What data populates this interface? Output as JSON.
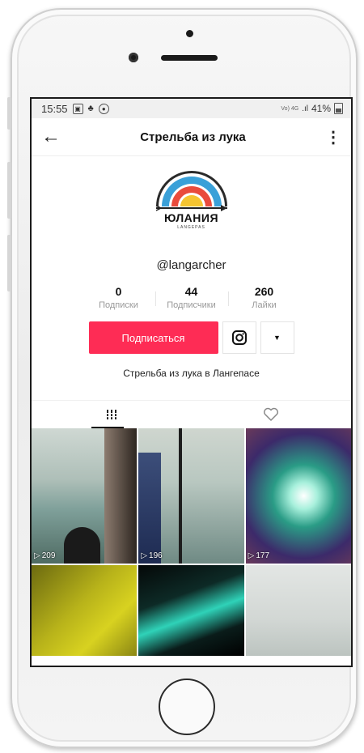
{
  "status_bar": {
    "time": "15:55",
    "network": "Vo) 4G",
    "battery": "41%"
  },
  "header": {
    "title": "Стрельба из лука"
  },
  "logo": {
    "text": "ЮЛАНИЯ",
    "subtext": "LANGEPAS"
  },
  "profile": {
    "username": "@langarcher",
    "bio": "Стрельба из лука в Лангепасе"
  },
  "stats": [
    {
      "value": "0",
      "label": "Подписки"
    },
    {
      "value": "44",
      "label": "Подписчики"
    },
    {
      "value": "260",
      "label": "Лайки"
    }
  ],
  "actions": {
    "follow_label": "Подписаться"
  },
  "videos": [
    {
      "views": "209"
    },
    {
      "views": "196"
    },
    {
      "views": "177"
    },
    {
      "views": ""
    },
    {
      "views": ""
    },
    {
      "views": ""
    }
  ],
  "colors": {
    "accent": "#fe2c55"
  },
  "icons": [
    "back-arrow-icon",
    "more-vertical-icon",
    "instagram-icon",
    "dropdown-arrow-icon",
    "grid-videos-icon",
    "heart-icon",
    "play-icon"
  ]
}
